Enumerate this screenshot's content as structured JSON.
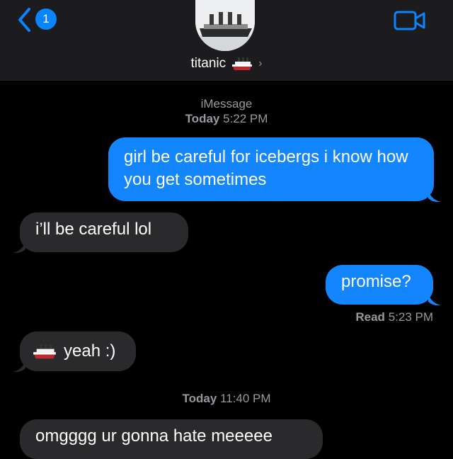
{
  "header": {
    "back_badge": "1",
    "contact_name": "titanic",
    "chevron": "›",
    "icons": [
      "back-chevron-icon",
      "ship-icon",
      "video-camera-icon"
    ]
  },
  "thread": {
    "service_label": "iMessage",
    "timestamp_1_day": "Today",
    "timestamp_1_time": "5:22 PM",
    "msg_1": "girl be careful for icebergs i know how you get sometimes",
    "msg_2": "i’ll be careful lol",
    "msg_3": "promise?",
    "read_label": "Read",
    "read_time": "5:23 PM",
    "msg_4_text": "yeah :)",
    "timestamp_2_day": "Today",
    "timestamp_2_time": "11:40 PM",
    "msg_5": "omgggg ur gonna hate meeeee"
  },
  "colors": {
    "sent_bubble": "#1386ff",
    "received_bubble": "#2a2a2c",
    "header_bg": "#1c1c1e",
    "accent": "#0a84ff"
  }
}
